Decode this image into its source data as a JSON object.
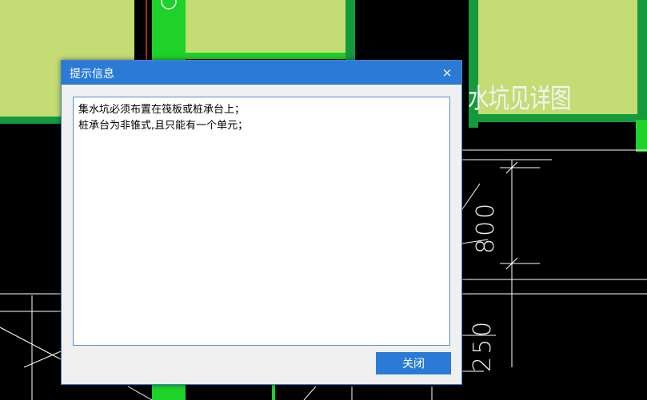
{
  "background": {
    "canvas_color": "#000000",
    "slab_fill": "#c3dc74",
    "wall_color": "#1ed22a",
    "dark_wall_color": "#149a3c",
    "hint_text": "水坑见详图",
    "dimensions": [
      "800",
      "250"
    ]
  },
  "dialog": {
    "title": "提示信息",
    "close_icon": "×",
    "messages": [
      "集水坑必须布置在筏板或桩承台上；",
      "桩承台为非锥式,且只能有一个单元；"
    ],
    "close_button": "关闭",
    "accent_color": "#2b7bd6"
  }
}
